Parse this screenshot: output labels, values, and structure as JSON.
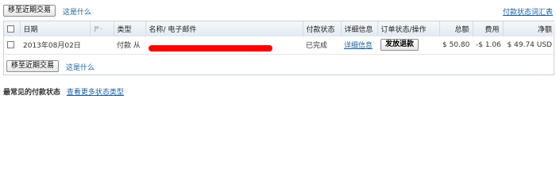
{
  "toolbar": {
    "move_button": "移至近期交易",
    "whats_this": "这是什么",
    "summary_link": "付款状态词汇表"
  },
  "table": {
    "headers": {
      "date": "日期",
      "type": "类型",
      "name_email": "名称/ 电子邮件",
      "payment_status": "付款状态",
      "details": "详细信息",
      "order_status": "订单状态/操作",
      "gross": "总额",
      "fee": "费用",
      "net": "净额"
    },
    "rows": [
      {
        "date": "2013年08月02日",
        "type": "付款 从",
        "name_email": "",
        "payment_status": "已完成",
        "details": "详细信息",
        "action": "发放退款",
        "gross": "$ 50.80",
        "fee": "-$ 1.06",
        "net": "$ 49.74 USD"
      }
    ]
  },
  "bottom_bar": {
    "move_button": "移至近期交易",
    "whats_this": "这是什么"
  },
  "status_section": {
    "title": "最常见的付款状态",
    "more_link": "查看更多状态类型"
  },
  "colors": {
    "link": "#1a5f9e",
    "redaction": "#ff0000",
    "header_bg": "#e3e9f0"
  },
  "icons": {
    "flag": "flag-icon"
  }
}
